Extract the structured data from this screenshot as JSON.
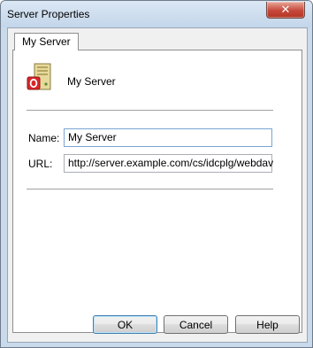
{
  "window": {
    "title": "Server Properties",
    "close_glyph": "✕"
  },
  "tabs": [
    {
      "label": "My Server",
      "active": true
    }
  ],
  "header": {
    "icon": "server-icon",
    "server_name": "My Server"
  },
  "form": {
    "name": {
      "label": "Name:",
      "value": "My Server"
    },
    "url": {
      "label": "URL:",
      "value": "http://server.example.com/cs/idcplg/webdav"
    }
  },
  "buttons": {
    "ok": "OK",
    "cancel": "Cancel",
    "help": "Help"
  },
  "colors": {
    "icon_red": "#d8262a",
    "icon_body": "#e6d99a"
  }
}
